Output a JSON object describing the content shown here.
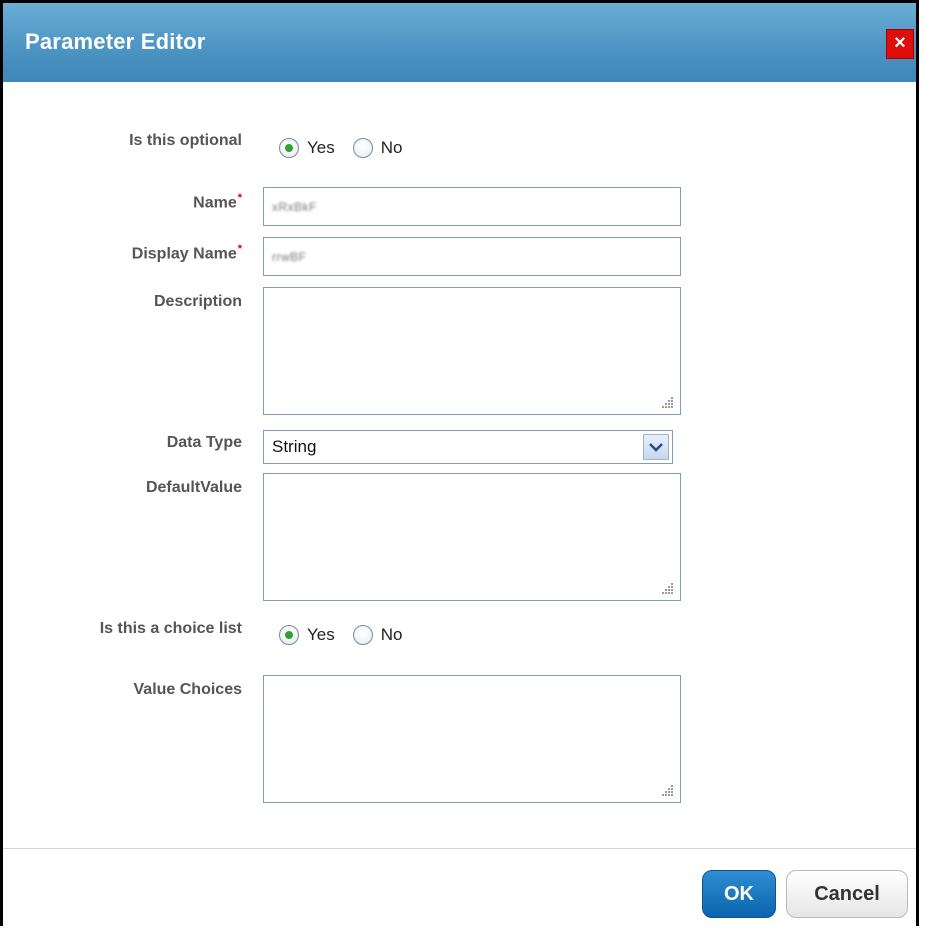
{
  "dialog": {
    "title": "Parameter Editor",
    "close_label": "×"
  },
  "form": {
    "optional": {
      "label": "Is this optional",
      "options": [
        {
          "label": "Yes",
          "selected": true
        },
        {
          "label": "No",
          "selected": false
        }
      ]
    },
    "name": {
      "label": "Name",
      "required_mark": "*",
      "value": "xRxBkF"
    },
    "display_name": {
      "label": "Display Name",
      "required_mark": "*",
      "value": "rrwBF"
    },
    "description": {
      "label": "Description",
      "value": ""
    },
    "data_type": {
      "label": "Data Type",
      "value": "String"
    },
    "default_value": {
      "label": "DefaultValue",
      "value": ""
    },
    "choice_list": {
      "label": "Is this a choice list",
      "options": [
        {
          "label": "Yes",
          "selected": true
        },
        {
          "label": "No",
          "selected": false
        }
      ]
    },
    "value_choices": {
      "label": "Value Choices",
      "value": ""
    }
  },
  "footer": {
    "ok_label": "OK",
    "cancel_label": "Cancel"
  },
  "colors": {
    "title_bar": "#4d95c4",
    "close_button": "#e00d0d",
    "ok_button": "#1a76bf",
    "radio_selected": "#2fa32f",
    "required_mark": "#d00000"
  }
}
